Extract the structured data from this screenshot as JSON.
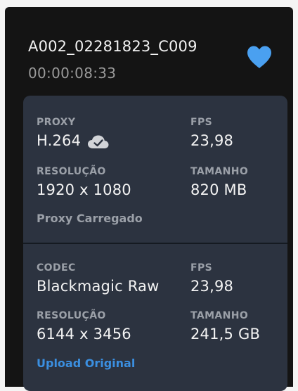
{
  "clip": {
    "name": "A002_02281823_C009",
    "timecode": "00:00:08:33",
    "favorite_icon": "heart-icon"
  },
  "colors": {
    "background": "#141414",
    "card": "#2c3340",
    "accent": "#3b8fe0",
    "label": "#9ba0a8"
  },
  "proxy": {
    "codec_label": "PROXY",
    "codec_value": "H.264",
    "cloud_icon": "cloud-check-icon",
    "fps_label": "FPS",
    "fps_value": "23,98",
    "resolution_label": "RESOLUÇÃO",
    "resolution_value": "1920 x 1080",
    "size_label": "TAMANHO",
    "size_value": "820 MB",
    "status": "Proxy Carregado"
  },
  "original": {
    "codec_label": "CODEC",
    "codec_value": "Blackmagic Raw",
    "fps_label": "FPS",
    "fps_value": "23,98",
    "resolution_label": "RESOLUÇÃO",
    "resolution_value": "6144 x 3456",
    "size_label": "TAMANHO",
    "size_value": "241,5 GB",
    "action": "Upload Original"
  }
}
